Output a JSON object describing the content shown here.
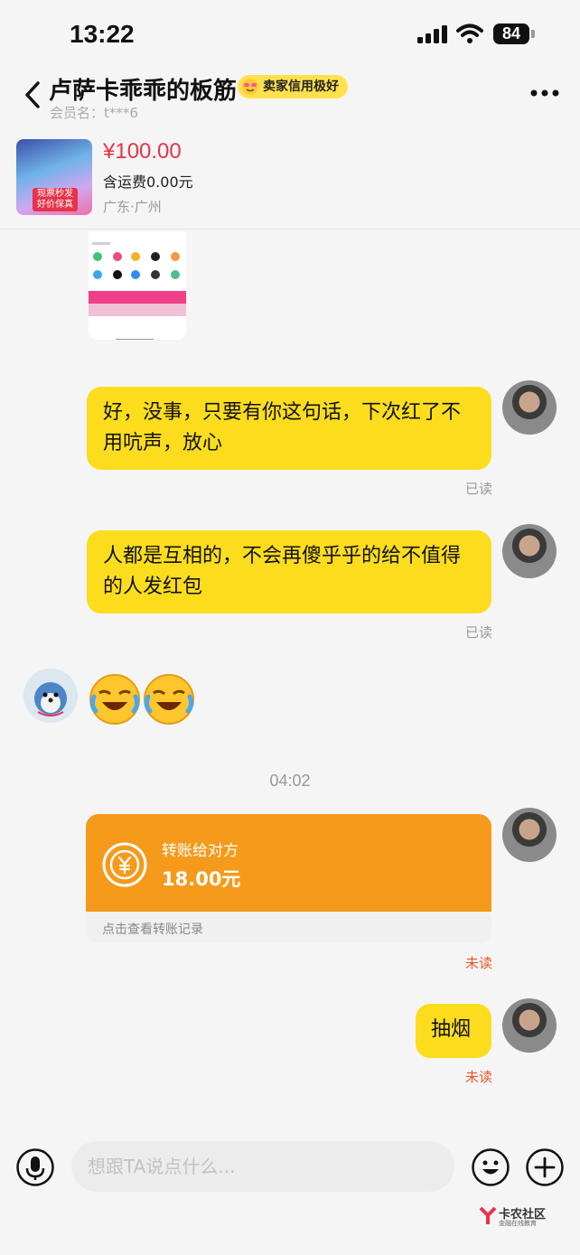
{
  "status_bar": {
    "time": "13:22",
    "battery": "84"
  },
  "header": {
    "title": "卢萨卡乖乖的板筋",
    "credit_badge": "卖家信用极好",
    "member_label": "会员名：t***6"
  },
  "product": {
    "price": "¥100.00",
    "shipping": "含运费0.00元",
    "location": "广东·广州",
    "thumb_tag_line1": "现票秒发",
    "thumb_tag_line2": "好价保真"
  },
  "messages": [
    {
      "text": "好，没事，只要有你这句话，下次红了不用吭声，放心",
      "status": "已读"
    },
    {
      "text": "人都是互相的，不会再傻乎乎的给不值得的人发红包",
      "status": "已读"
    }
  ],
  "time_separator": "04:02",
  "transfer": {
    "title": "转账给对方",
    "amount": "18.00元",
    "footer": "点击查看转账记录",
    "status": "未读"
  },
  "last_message": {
    "text": "抽烟",
    "status": "未读"
  },
  "input": {
    "placeholder": "想跟TA说点什么..."
  },
  "watermark": {
    "name": "卡农社区",
    "subtitle": "金融在线教育"
  },
  "colors": {
    "bubble": "#fcdd1d",
    "transfer": "#f59a1b",
    "price": "#e8334a",
    "unread": "#e8582c"
  }
}
